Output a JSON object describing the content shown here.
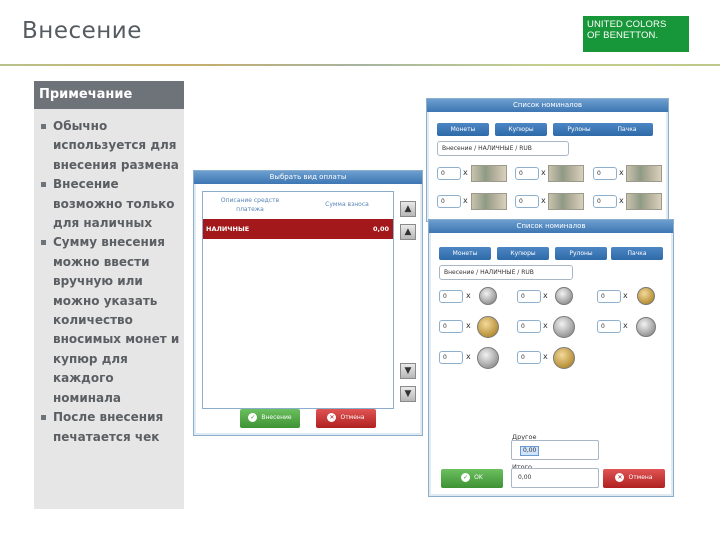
{
  "slide": {
    "title": "Внесение",
    "logo_line1": "UNITED COLORS",
    "logo_line2": "OF BENETTON."
  },
  "note": {
    "heading": "Примечание",
    "items": [
      "Обычно используется для внесения размена",
      "Внесение возможно только для наличных",
      "Сумму внесения можно ввести вручную или можно указать количество вносимых монет и купюр для каждого номинала",
      "После внесения печатается чек"
    ]
  },
  "payment_window": {
    "title": "Выбрать вид оплаты",
    "col_method": "Описание средств платежа",
    "col_amount": "Сумма взноса",
    "row_method": "НАЛИЧНЫЕ",
    "row_amount": "0,00",
    "deposit_button": "Внесение",
    "cancel_button": "Отмена"
  },
  "banknote_window": {
    "title": "Список номиналов",
    "tabs": [
      "Монеты",
      "Купюры",
      "Рулоны",
      "Пачка"
    ],
    "selection": "Внесение / НАЛИЧНЫЕ / RUB",
    "quantities": [
      "0",
      "0",
      "0",
      "0",
      "0",
      "0"
    ]
  },
  "coin_window": {
    "title": "Список номиналов",
    "tabs": [
      "Монеты",
      "Купюры",
      "Рулоны",
      "Пачка"
    ],
    "selection": "Внесение / НАЛИЧНЫЕ / RUB",
    "quantities": [
      "0",
      "0",
      "0",
      "0",
      "0",
      "0",
      "0",
      "0"
    ],
    "other_label": "Другое",
    "other_value": "0,00",
    "total_label": "Итого",
    "total_value": "0,00",
    "ok_button": "OK",
    "cancel_button": "Отмена"
  },
  "colors": {
    "accent_blue": "#3d76b3",
    "row_red": "#a3181b",
    "ok_green": "#3d9233",
    "logo_green": "#18963a"
  }
}
